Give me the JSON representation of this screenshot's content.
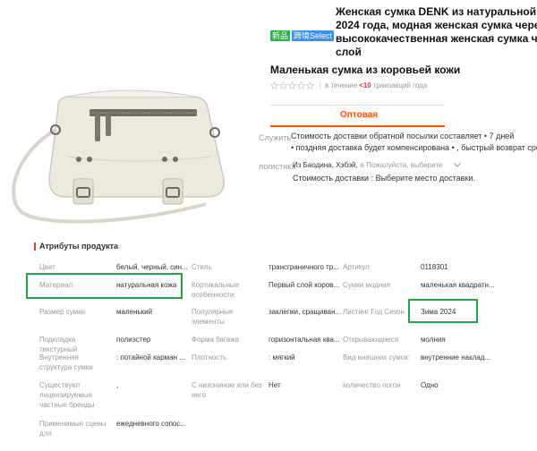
{
  "product": {
    "badge_new": "新品",
    "badge_select": "跨境Select",
    "title_lines": [
      "Женская сумка DENK из натуральной кож",
      "2024 года, модная женская сумка через п",
      "высококачественная женская сумка чере",
      "слой"
    ],
    "subtitle": "Маленькая сумка из коровьей кожи",
    "rating": {
      "stars_filled": 0,
      "stars_total": 5,
      "prefix": "в течение",
      "count": "<10",
      "suffix": "транзакций года"
    },
    "tab_label": "Оптовая"
  },
  "service": {
    "label": "Служить",
    "line1": "Стоимость доставки обратной посылки составляет • 7 дней",
    "line2": "• поздняя доставка будет компенсирована • , быстрый возврат средств"
  },
  "logistics": {
    "label": "логистика",
    "from": "Из Баодина, Хэбэй,",
    "hint": "в Пожалуйста, выберите",
    "shipping_cost": "Стоимость доставки : Выберите место доставки."
  },
  "attributes": {
    "heading": "Атрибуты продукта",
    "rows": [
      [
        [
          "Цвет",
          "белый, черный, син..."
        ],
        [
          "Стиль",
          "трансграничного тр..."
        ],
        [
          "Артикул",
          "0118301"
        ]
      ],
      [
        [
          "Материал",
          "натуральная кожа"
        ],
        [
          "Кортикальные особенности:",
          "Первый слой коров..."
        ],
        [
          "Сумки модная",
          "маленькая квадратн..."
        ]
      ],
      [
        [
          "Размер сумки",
          "маленький"
        ],
        [
          "Популярные элементы",
          "заклепки, сращиван..."
        ],
        [
          "Листинг Год Сезон",
          "Зима 2024"
        ]
      ],
      [
        [
          "Подкладка текстурный",
          "полиэстер"
        ],
        [
          "Форма багажа",
          "горизонтальная ква..."
        ],
        [
          "Открывающиеся",
          "молния"
        ]
      ],
      [
        [
          "Внутренняя структура сумки",
          ": потайной карман ..."
        ],
        [
          "Плотность",
          ": мягкий"
        ],
        [
          "Вид внешних сумок:",
          "внутренние наклад..."
        ]
      ],
      [
        [
          "Существуют лицензируемые частные бренды",
          ","
        ],
        [
          "С низонином или без него",
          "Нет"
        ],
        [
          "количество погон",
          "Одно"
        ]
      ],
      [
        [
          "Применимые сцены для",
          "ежедневного сопос..."
        ]
      ]
    ]
  },
  "colors": {
    "accent": "#ff5000",
    "price_red": "#e4393c",
    "highlight_green": "#22a447",
    "badge_green": "#2fb14c",
    "badge_blue": "#3b8ff0"
  }
}
